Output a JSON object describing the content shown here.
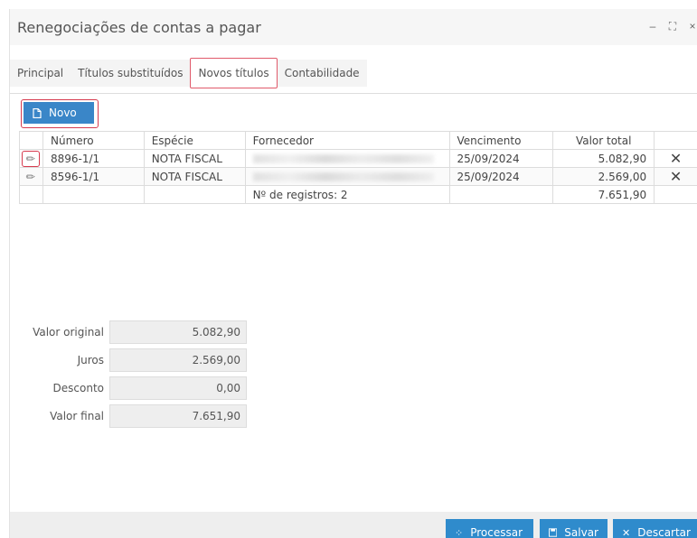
{
  "window": {
    "title": "Renegociações de contas a pagar",
    "minimize": "–",
    "maximize": "⛶",
    "close": "×"
  },
  "tabs": [
    {
      "label": "Principal"
    },
    {
      "label": "Títulos substituídos"
    },
    {
      "label": "Novos títulos",
      "active": true
    },
    {
      "label": "Contabilidade"
    }
  ],
  "toolbar": {
    "novo_label": "Novo"
  },
  "grid": {
    "columns": [
      "Número",
      "Espécie",
      "Fornecedor",
      "Vencimento",
      "Valor total"
    ],
    "rows": [
      {
        "numero": "8896-1/1",
        "especie": "NOTA FISCAL",
        "vencimento": "25/09/2024",
        "valor": "5.082,90"
      },
      {
        "numero": "8596-1/1",
        "especie": "NOTA FISCAL",
        "vencimento": "25/09/2024",
        "valor": "2.569,00"
      }
    ],
    "footer": {
      "registros": "Nº de registros: 2",
      "total": "7.651,90"
    }
  },
  "summary": {
    "valor_original": {
      "label": "Valor original",
      "value": "5.082,90"
    },
    "juros": {
      "label": "Juros",
      "value": "2.569,00"
    },
    "desconto": {
      "label": "Desconto",
      "value": "0,00"
    },
    "valor_final": {
      "label": "Valor final",
      "value": "7.651,90"
    }
  },
  "actions": {
    "processar": "Processar",
    "salvar": "Salvar",
    "descartar": "Descartar"
  }
}
